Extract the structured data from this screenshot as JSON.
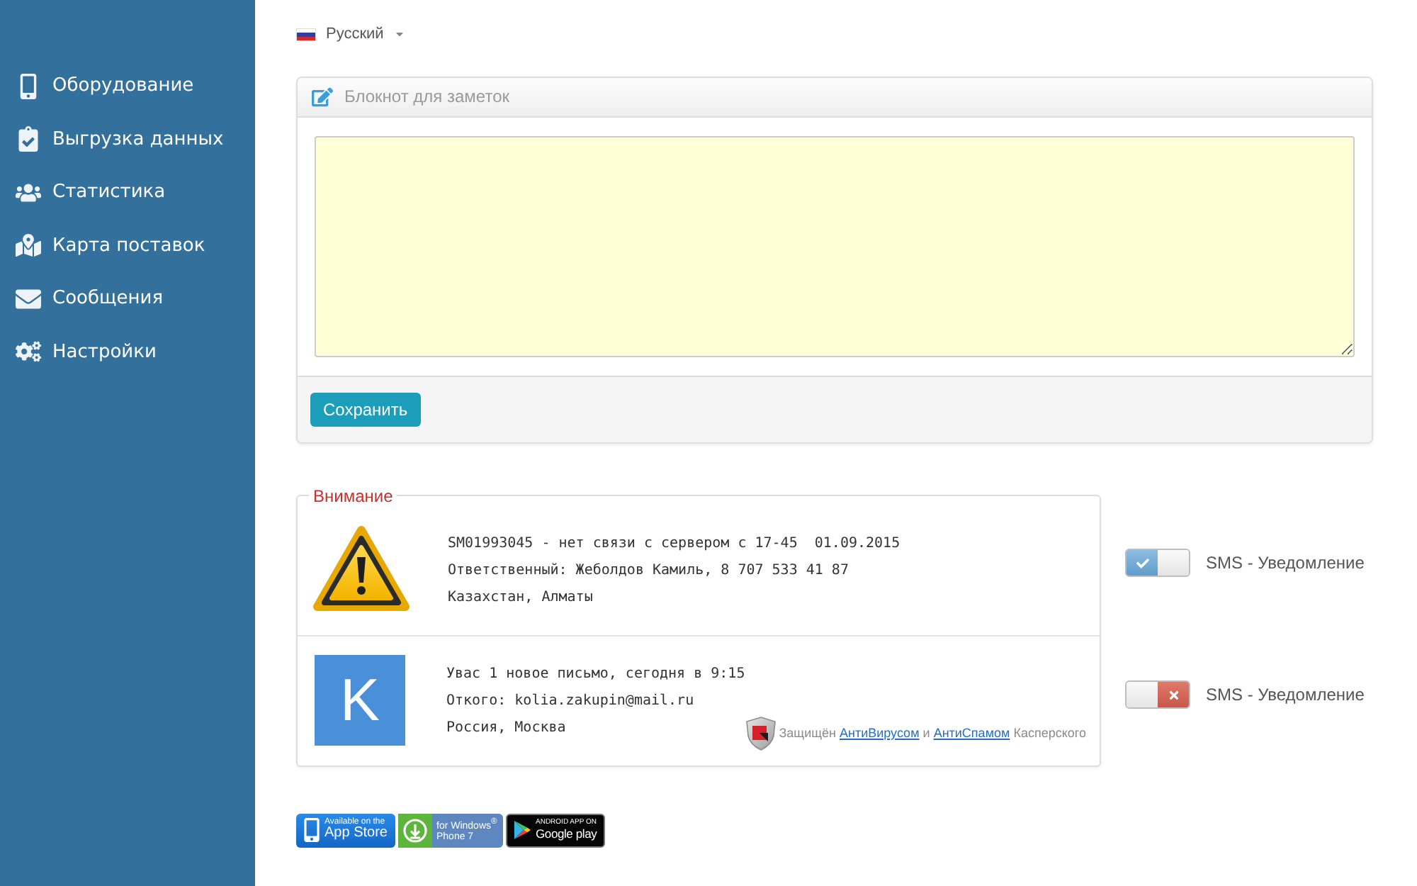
{
  "language": {
    "label": "Русский"
  },
  "sidebar": {
    "items": [
      {
        "label": "Оборудование",
        "selected": false
      },
      {
        "label": "Выгрузка данных",
        "selected": false
      },
      {
        "label": "Статистика",
        "selected": false
      },
      {
        "label": "Карта поставок",
        "selected": false
      },
      {
        "label": "Сообщения",
        "selected": false
      },
      {
        "label": "Настройки",
        "selected": false
      }
    ]
  },
  "notepad": {
    "title": "Блокнот для заметок",
    "save_button": "Сохранить"
  },
  "alerts": {
    "legend": "Внимание",
    "items": [
      {
        "kind": "warning",
        "lines": [
          "SM01993045 - нет связи с сервером с 17-45  01.09.2015",
          "Ответственный: Жеболдов Камиль, 8 707 533 41 87",
          "Казахстан, Алматы"
        ],
        "sms": {
          "label": "SMS - Уведомление",
          "on": true
        }
      },
      {
        "kind": "letter",
        "avatar": "K",
        "lines": [
          "Увас 1 новое письмо, сегодня в 9:15",
          "Откого: kolia.zakupin@mail.ru",
          "Россия, Москва"
        ],
        "protection": {
          "parts": [
            {
              "kind": "text",
              "text": "Защищён"
            },
            {
              "kind": "link",
              "text": "АнтиВирусом"
            },
            {
              "kind": "text",
              "text": "и"
            },
            {
              "kind": "link",
              "text": "АнтиСпамом"
            },
            {
              "kind": "text",
              "text": "Касперского"
            }
          ]
        },
        "sms": {
          "label": "SMS - Уведомление",
          "on": false
        }
      }
    ]
  },
  "stores": [
    {
      "kind": "appstore",
      "top": "Available on the",
      "bottom": "App Store"
    },
    {
      "kind": "windows",
      "top": "for Windows$^{®}$",
      "bottom": "Phone 7"
    },
    {
      "kind": "googleplay",
      "top": "ANDROID APP ON",
      "bottom": "Google play"
    }
  ]
}
